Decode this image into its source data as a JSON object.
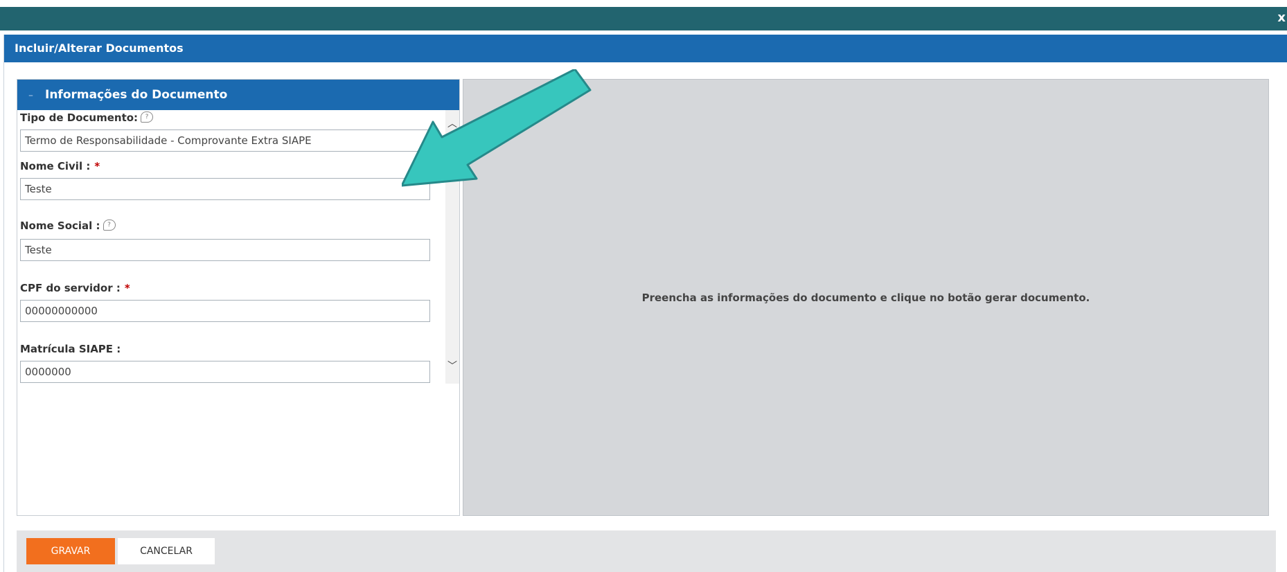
{
  "window": {
    "close_glyph": "x"
  },
  "dialog": {
    "title": "Incluir/Alterar Documentos"
  },
  "panel": {
    "title": "Informações do Documento",
    "fields": {
      "tipo_documento": {
        "label": "Tipo de Documento:",
        "value": "Termo de Responsabilidade - Comprovante Extra SIAPE"
      },
      "nome_civil": {
        "label": "Nome Civil :",
        "required_mark": "*",
        "value": "Teste"
      },
      "nome_social": {
        "label": "Nome Social :",
        "value": "Teste"
      },
      "cpf_servidor": {
        "label": "CPF do servidor :",
        "required_mark": "*",
        "value": "00000000000"
      },
      "matricula_siape": {
        "label": "Matrícula SIAPE :",
        "value": "0000000"
      }
    }
  },
  "preview": {
    "message": "Preencha as informações do documento e clique no botão gerar documento."
  },
  "footer": {
    "save_label": "GRAVAR",
    "cancel_label": "CANCELAR"
  },
  "colors": {
    "titlebar": "#22646f",
    "header_blue": "#1b6ab0",
    "save_orange": "#f26f1e",
    "annotation_arrow": "#37c6bd"
  },
  "icons": {
    "help": "help-icon",
    "scroll_up": "chevron-up-icon",
    "scroll_down": "chevron-down-icon",
    "collapse": "collapse-icon",
    "close": "close-icon"
  }
}
